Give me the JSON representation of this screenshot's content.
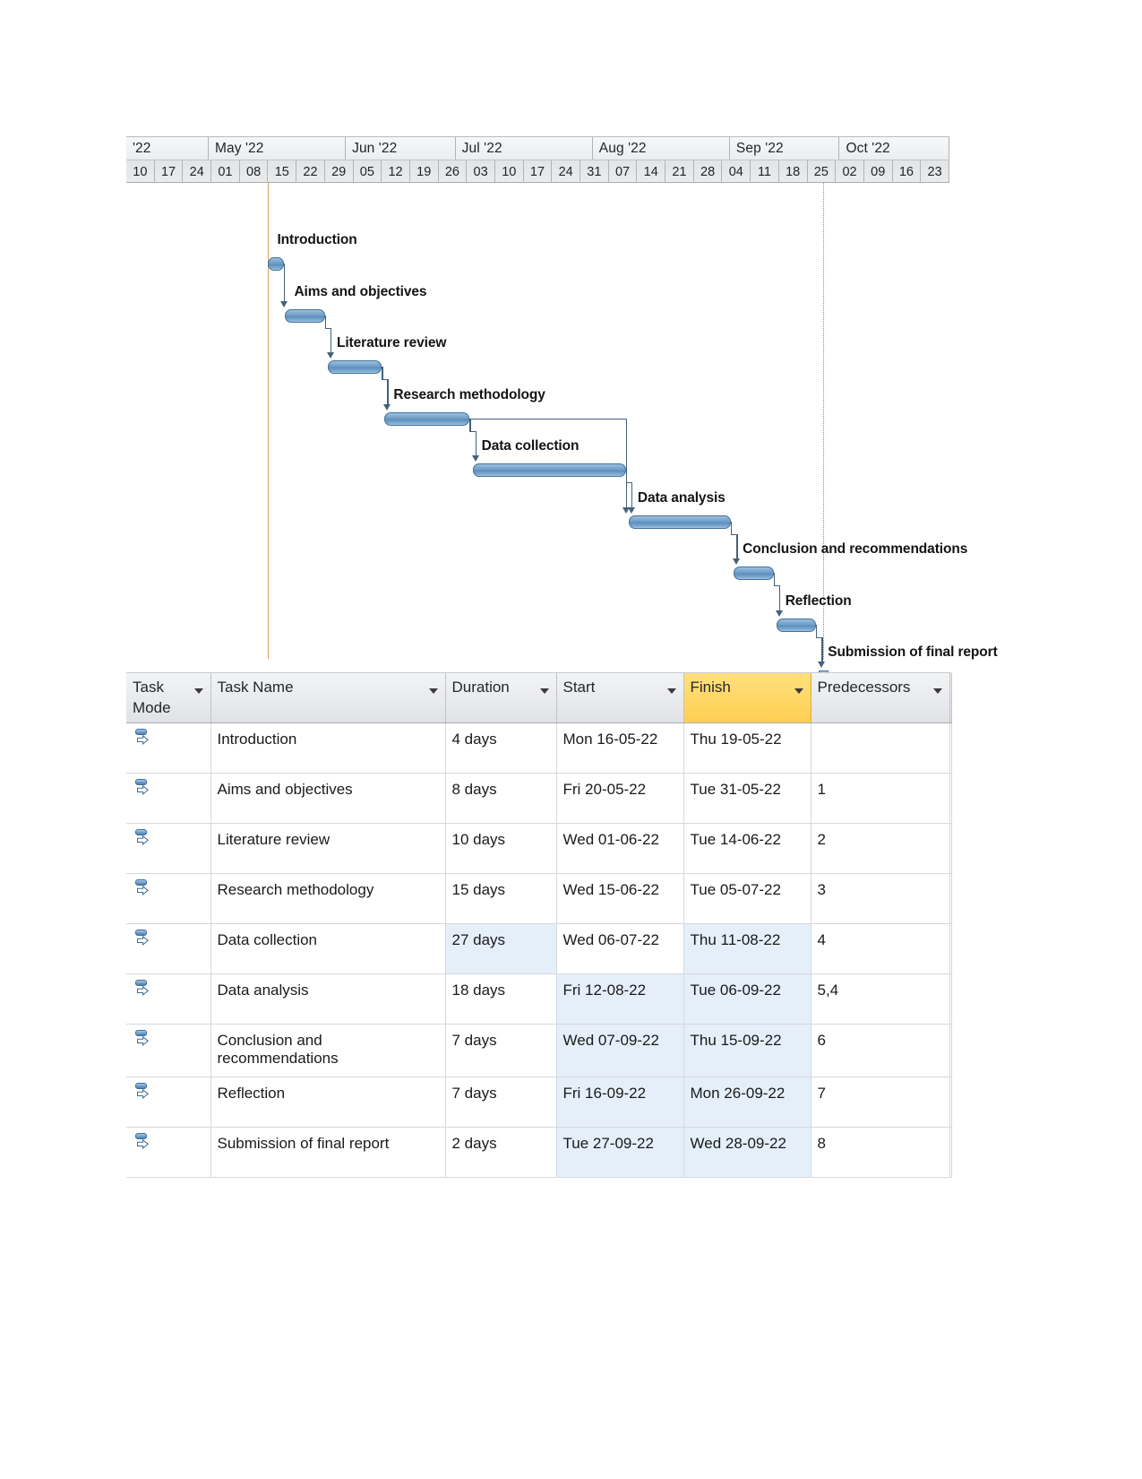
{
  "gantt": {
    "timeline": {
      "months": [
        {
          "label": "'22",
          "weeks": 3
        },
        {
          "label": "May '22",
          "weeks": 5
        },
        {
          "label": "Jun '22",
          "weeks": 4
        },
        {
          "label": "Jul '22",
          "weeks": 5
        },
        {
          "label": "Aug '22",
          "weeks": 5
        },
        {
          "label": "Sep '22",
          "weeks": 4
        },
        {
          "label": "Oct '22",
          "weeks": 4
        }
      ],
      "weeks": [
        "10",
        "17",
        "24",
        "01",
        "08",
        "15",
        "22",
        "29",
        "05",
        "12",
        "19",
        "26",
        "03",
        "10",
        "17",
        "24",
        "31",
        "07",
        "14",
        "21",
        "28",
        "04",
        "11",
        "18",
        "25",
        "02",
        "09",
        "16",
        "23"
      ]
    },
    "bars": [
      {
        "label": "Introduction",
        "type": "bar",
        "start_wk": 5.0,
        "end_wk": 5.55
      },
      {
        "label": "Aims and objectives",
        "type": "bar",
        "start_wk": 5.6,
        "end_wk": 7.0
      },
      {
        "label": "Literature review",
        "type": "bar",
        "start_wk": 7.1,
        "end_wk": 9.0
      },
      {
        "label": "Research methodology",
        "type": "bar",
        "start_wk": 9.1,
        "end_wk": 12.1
      },
      {
        "label": "Data collection",
        "type": "bar",
        "start_wk": 12.2,
        "end_wk": 17.6
      },
      {
        "label": "Data analysis",
        "type": "bar",
        "start_wk": 17.7,
        "end_wk": 21.3
      },
      {
        "label": "Conclusion and recommendations",
        "type": "bar",
        "start_wk": 21.4,
        "end_wk": 22.8
      },
      {
        "label": "Reflection",
        "type": "bar",
        "start_wk": 22.9,
        "end_wk": 24.3
      },
      {
        "label": "Submission of final report",
        "type": "milestone",
        "start_wk": 24.4,
        "end_wk": 24.8
      }
    ]
  },
  "table": {
    "headers": [
      {
        "line1": "Task",
        "line2": "Mode",
        "highlight": false,
        "caret": true
      },
      {
        "line1": "Task Name",
        "line2": "",
        "highlight": false,
        "caret": true
      },
      {
        "line1": "Duration",
        "line2": "",
        "highlight": false,
        "caret": true
      },
      {
        "line1": "Start",
        "line2": "",
        "highlight": false,
        "caret": true
      },
      {
        "line1": "Finish",
        "line2": "",
        "highlight": true,
        "caret": true
      },
      {
        "line1": "Predecessors",
        "line2": "",
        "highlight": false,
        "caret": true
      },
      {
        "line1": "",
        "line2": "",
        "highlight": false,
        "caret": false
      }
    ],
    "rows": [
      {
        "mode_icon": "manually-scheduled-icon",
        "name": "Introduction",
        "duration": "4 days",
        "start": "Mon 16-05-22",
        "finish": "Thu 19-05-22",
        "predecessors": "",
        "tint": {
          "duration": false,
          "start": false,
          "finish": false
        }
      },
      {
        "mode_icon": "manually-scheduled-icon",
        "name": "Aims and objectives",
        "duration": "8 days",
        "start": "Fri 20-05-22",
        "finish": "Tue 31-05-22",
        "predecessors": "1",
        "tint": {
          "duration": false,
          "start": false,
          "finish": false
        }
      },
      {
        "mode_icon": "manually-scheduled-icon",
        "name": "Literature review",
        "duration": "10 days",
        "start": "Wed 01-06-22",
        "finish": "Tue 14-06-22",
        "predecessors": "2",
        "tint": {
          "duration": false,
          "start": false,
          "finish": false
        }
      },
      {
        "mode_icon": "manually-scheduled-icon",
        "name": "Research methodology",
        "duration": "15 days",
        "start": "Wed 15-06-22",
        "finish": "Tue 05-07-22",
        "predecessors": "3",
        "tint": {
          "duration": false,
          "start": false,
          "finish": false
        }
      },
      {
        "mode_icon": "manually-scheduled-icon",
        "name": "Data collection",
        "duration": "27 days",
        "start": "Wed 06-07-22",
        "finish": "Thu 11-08-22",
        "predecessors": "4",
        "tint": {
          "duration": true,
          "start": false,
          "finish": true
        }
      },
      {
        "mode_icon": "manually-scheduled-icon",
        "name": "Data analysis",
        "duration": "18 days",
        "start": "Fri 12-08-22",
        "finish": "Tue 06-09-22",
        "predecessors": "5,4",
        "tint": {
          "duration": false,
          "start": true,
          "finish": true
        }
      },
      {
        "mode_icon": "manually-scheduled-icon",
        "name": "Conclusion and recommendations",
        "duration": "7 days",
        "start": "Wed 07-09-22",
        "finish": "Thu 15-09-22",
        "predecessors": "6",
        "tint": {
          "duration": false,
          "start": true,
          "finish": true
        }
      },
      {
        "mode_icon": "manually-scheduled-icon",
        "name": "Reflection",
        "duration": "7 days",
        "start": "Fri 16-09-22",
        "finish": "Mon 26-09-22",
        "predecessors": "7",
        "tint": {
          "duration": false,
          "start": true,
          "finish": true
        }
      },
      {
        "mode_icon": "manually-scheduled-icon",
        "name": "Submission of final report",
        "duration": "2 days",
        "start": "Tue 27-09-22",
        "finish": "Wed 28-09-22",
        "predecessors": "8",
        "tint": {
          "duration": false,
          "start": true,
          "finish": true
        }
      }
    ]
  },
  "colors": {
    "bar_fill": "#6d9cc6",
    "bar_border": "#41719c",
    "header_highlight": "#ffd765",
    "cell_tint": "#e4effa",
    "today_line": "#d1a36a",
    "status_line": "#8d8d8d"
  }
}
